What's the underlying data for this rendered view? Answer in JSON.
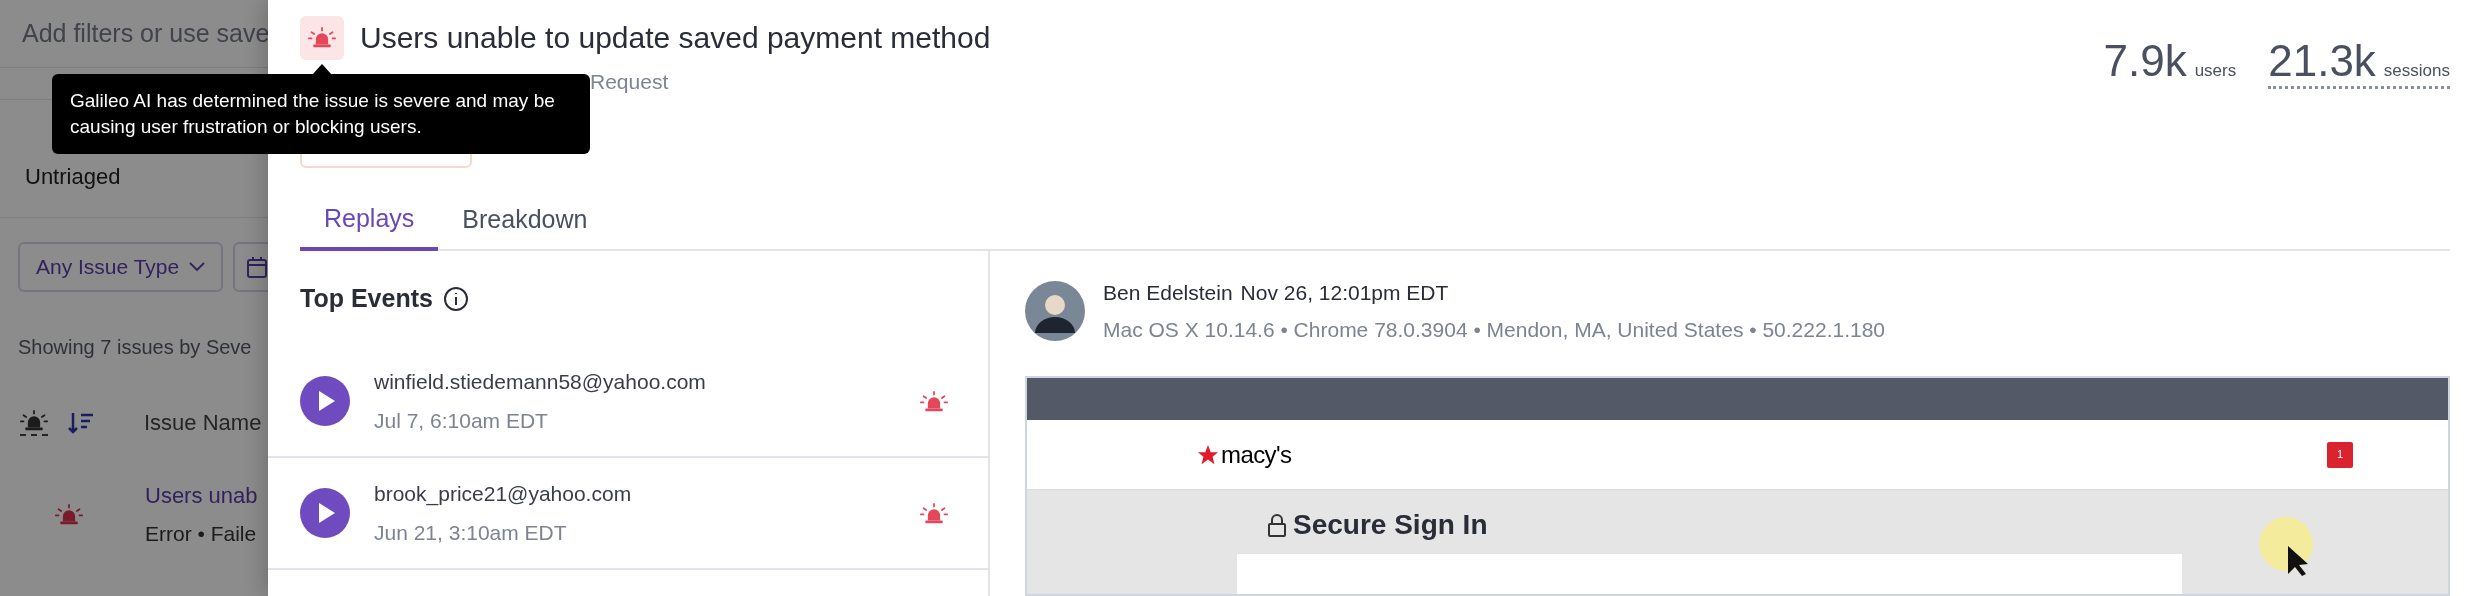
{
  "background_page": {
    "search": {
      "placeholder": "Add filters or use save"
    },
    "triage_tab": "Untriaged",
    "filters": [
      {
        "label": "Any Issue Type"
      }
    ],
    "summary": "Showing 7 issues by Seve",
    "columns": [
      "Issue Name"
    ],
    "issues": [
      {
        "name": "Users unab",
        "subtitle": "Error • Faile"
      }
    ]
  },
  "issue": {
    "title": "Users unable to update saved payment method",
    "subtitle": "Request",
    "stats": [
      {
        "value": "7.9k",
        "unit": "users",
        "underlined": false
      },
      {
        "value": "21.3k",
        "unit": "sessions",
        "underlined": true
      }
    ]
  },
  "tooltip": {
    "text": "Galileo AI has determined the issue is severe and may be causing user frustration or blocking users."
  },
  "tabs": [
    {
      "label": "Replays",
      "selected": true
    },
    {
      "label": "Breakdown",
      "selected": false
    }
  ],
  "top_events": {
    "title": "Top Events",
    "events": [
      {
        "email": "winfield.stiedemann58@yahoo.com",
        "time": "Jul 7, 6:10am EDT"
      },
      {
        "email": "brook_price21@yahoo.com",
        "time": "Jun 21, 3:10am EDT"
      }
    ]
  },
  "session": {
    "user": "Ben Edelstein",
    "time": "Nov 26, 12:01pm EDT",
    "meta": "Mac OS X 10.14.6 • Chrome 78.0.3904 • Mendon, MA, United States • 50.222.1.180"
  },
  "replay": {
    "logo": "macy's",
    "bag_count": "1",
    "heading": "Secure Sign In"
  }
}
